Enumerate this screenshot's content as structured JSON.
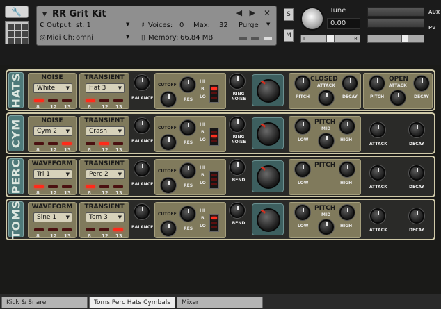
{
  "header": {
    "title": "RR Grit Kit",
    "output_label": "Output:",
    "output_value": "st. 1",
    "midi_label": "Midi Ch:",
    "midi_value": "omni",
    "voices_label": "Voices:",
    "voices_value": "0",
    "max_label": "Max:",
    "max_value": "32",
    "purge_label": "Purge",
    "memory_label": "Memory:",
    "memory_value": "66.84 MB",
    "solo": "S",
    "mute": "M",
    "tune_label": "Tune",
    "tune_value": "0.00",
    "pan_left": "L",
    "pan_right": "R",
    "aux": "AUX",
    "pv": "PV"
  },
  "labels": {
    "balance": "BALANCE",
    "cutoff": "CUTOFF",
    "res": "RES",
    "hi": "HI",
    "b": "B",
    "lo": "LO",
    "ring_noise": "RING NOISE",
    "bend": "BEND",
    "pitch": "PITCH",
    "attack": "ATTACK",
    "decay": "DECAY",
    "low": "LOW",
    "mid": "MID",
    "high": "HIGH",
    "n8": "8",
    "n12": "12",
    "n13": "13"
  },
  "rows": [
    {
      "name": "HATS",
      "src_title": "NOISE",
      "src_value": "White",
      "trans_title": "TRANSIENT",
      "trans_value": "Hat 3",
      "src_led": 0,
      "trans_led": 0,
      "filter_led": 0,
      "mod_label": "RING NOISE",
      "closed_title": "CLOSED",
      "open_title": "OPEN"
    },
    {
      "name": "CYM",
      "src_title": "NOISE",
      "src_value": "Cym 2",
      "trans_title": "TRANSIENT",
      "trans_value": "Crash",
      "src_led": 2,
      "trans_led": 1,
      "filter_led": 1,
      "mod_label": "RING NOISE",
      "pitch_title": "PITCH"
    },
    {
      "name": "PERC",
      "src_title": "WAVEFORM",
      "src_value": "Tri 1",
      "trans_title": "TRANSIENT",
      "trans_value": "Perc 2",
      "src_led": 0,
      "trans_led": 0,
      "filter_led": -1,
      "mod_label": "BEND",
      "pitch_title": "PITCH"
    },
    {
      "name": "TOMS",
      "src_title": "WAVEFORM",
      "src_value": "Sine 1",
      "trans_title": "TRANSIENT",
      "trans_value": "Tom 3",
      "src_led": -1,
      "trans_led": 2,
      "filter_led": 0,
      "mod_label": "BEND",
      "pitch_title": "PITCH"
    }
  ],
  "tabs": [
    "Kick & Snare",
    "Toms Perc Hats Cymbals",
    "Mixer"
  ],
  "active_tab": 1,
  "colors": {
    "panel_border": "#cfc9a8",
    "section_tag": "#4f7a7a",
    "box": "#807a5c",
    "led_on": "#ff2a1a"
  }
}
